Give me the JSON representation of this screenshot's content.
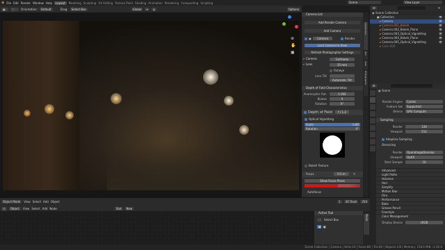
{
  "menu": [
    "File",
    "Edit",
    "Render",
    "Window",
    "Help"
  ],
  "workspaces": [
    "Layout",
    "Modeling",
    "Sculpting",
    "UV Editing",
    "Texture Paint",
    "Shading",
    "Animation",
    "Rendering",
    "Compositing",
    "Scripting"
  ],
  "scene": "Scene",
  "view_layer": "View Layer",
  "viewport": {
    "orientation_label": "Orientation:",
    "orientation": "Default",
    "drag_label": "Drag:",
    "drag": "Select Box",
    "transform": "Global",
    "options": "Options"
  },
  "camlist": {
    "tab": "Camera List",
    "title": "Camera List",
    "add_render_camera": "Add Render Camera",
    "add_camera": "Add Camera",
    "camera": "Camera",
    "render": "Render",
    "lock_camera": "Lock Camera to View",
    "refresh": "Refresh Photographer Settings"
  },
  "camera_panel": {
    "camera_label": "Camera",
    "camera_value": "Fullframe",
    "lens_label": "Lens",
    "lens_value": "35 mm",
    "fisheye": "Fisheye",
    "lens_tilt_label": "Lens Tilt",
    "auto_tilt": "Automatic Tilt"
  },
  "dof": {
    "characteristics": "Depth of Field Characteristics",
    "anamorphic_label": "Anamorphic Rat.",
    "anamorphic": "1.000",
    "blades_label": "Blades",
    "blades": "0",
    "rotation_label": "Rotation",
    "rotation": "0°",
    "title": "Depth of Field",
    "fstop": "f / 1.2",
    "optical_vignetting": "Optical Vignetting",
    "scale_label": "Scale",
    "scale": "0.80",
    "rot_label": "Rotation",
    "rot": "0°",
    "bokeh_texture": "Bokeh Texture"
  },
  "focus": {
    "label": "Focus",
    "value": "0.5 m",
    "show_focus_plane": "Show Focus Plane",
    "autofocus": "Autofocus"
  },
  "side_tabs": [
    "Camera List",
    "Tool",
    "View",
    "Photographer"
  ],
  "outliner": {
    "root": "Scene Collection",
    "items": [
      "Collection",
      "Camera",
      "Camera.001_Bokeh",
      "Camera.002_Bokeh_Plane",
      "Camera.003_Optical_Vignetting",
      "Camera.004_Bokeh_Plane",
      "Camera.005_Optical_Vignetting",
      "Cone.000"
    ]
  },
  "props": {
    "scene": "Scene",
    "render_engine_label": "Render Engine",
    "render_engine": "Cycles",
    "feature_set_label": "Feature Set",
    "feature_set": "Supported",
    "device_label": "Device",
    "device": "GPU Compute",
    "sampling": "Sampling",
    "render_label": "Render",
    "render_samples": "128",
    "viewport_label": "Viewport",
    "viewport_samples": "512",
    "adaptive": "Adaptive Sampling",
    "denoising": "Denoising",
    "denoise_render_label": "Render",
    "denoise_render": "OpenImageDenoise",
    "denoise_viewport_label": "Viewport",
    "denoise_viewport": "OptiX",
    "start_sample_label": "Start Sample",
    "start_sample": "16",
    "sections": [
      "Advanced",
      "Light Paths",
      "Volumes",
      "Hair",
      "Simplify",
      "Motion Blur",
      "Film",
      "Performance",
      "Bake",
      "Grease Pencil",
      "Freestyle",
      "Color Management"
    ],
    "display_device_label": "Display Device",
    "display_device": "sRGB"
  },
  "node": {
    "editor_type": "Object Mode",
    "menus": [
      "View",
      "Select",
      "Add",
      "Object"
    ],
    "menus2": [
      "View",
      "Select",
      "Add",
      "Node"
    ],
    "object": "Object",
    "new": "New",
    "slot": "Slot",
    "tab": "Node"
  },
  "active_tool": {
    "title": "Active Tool",
    "select_box": "Select Box"
  },
  "timeline": {
    "frame": "1",
    "fps": "30 Track",
    "end": "250"
  },
  "status": "Scene Collection | Camera | Verts:10 | Faces:80 | Tris:60 | Objects:1/8 | Memory: 158.6 MiB | 2.92.0"
}
